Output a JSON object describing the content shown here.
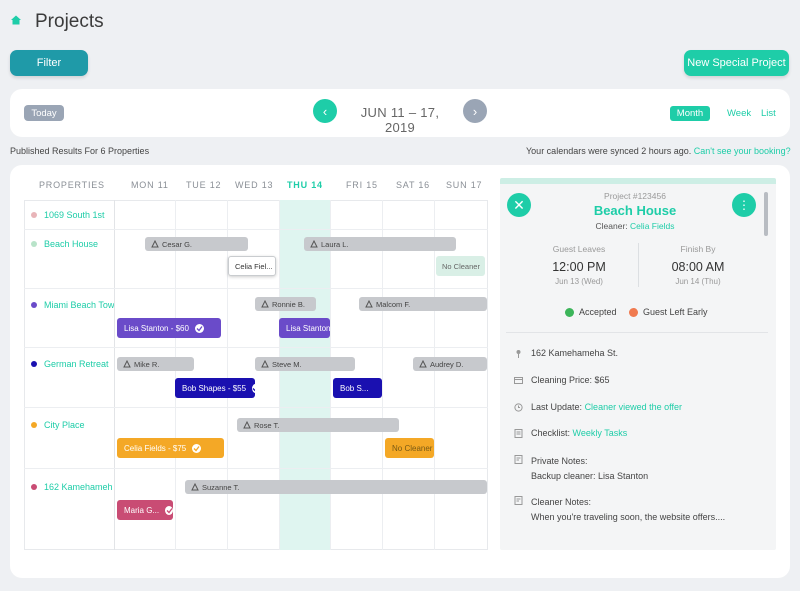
{
  "header": {
    "title": "Projects",
    "filter_label": "Filter",
    "new_project_label": "New Special Project"
  },
  "datebar": {
    "today": "Today",
    "range": "JUN 11 – 17, 2019",
    "views": {
      "month": "Month",
      "week": "Week",
      "list": "List"
    }
  },
  "status": {
    "published": "Published Results For 6 Properties",
    "synced": "Your calendars were synced 2 hours ago.",
    "synced_link": "Can't see your booking?"
  },
  "calendar": {
    "properties_header": "PROPERTIES",
    "days": [
      "MON 11",
      "TUE 12",
      "WED 13",
      "THU 14",
      "FRI 15",
      "SAT 16",
      "SUN 17"
    ],
    "properties": [
      {
        "name": "1069 South 1st",
        "color": "#e8b4b8"
      },
      {
        "name": "Beach House",
        "color": "#b8e3c9"
      },
      {
        "name": "Miami Beach Tow",
        "color": "#6a4bc9"
      },
      {
        "name": "German Retreat",
        "color": "#1a10b0"
      },
      {
        "name": "City Place",
        "color": "#f4a826"
      },
      {
        "name": "162 Kamehameh",
        "color": "#c94c74"
      }
    ],
    "events": {
      "cesar": "Cesar G.",
      "laura": "Laura L.",
      "celia_w": "Celia Fiel...",
      "no_cleaner_1": "No Cleaner",
      "ronnie": "Ronnie B.",
      "malcom": "Malcom F.",
      "lisa_60": "Lisa Stanton - $60",
      "lisa": "Lisa Stanton",
      "mike": "Mike R.",
      "steve": "Steve M.",
      "audrey": "Audrey D.",
      "bob_55": "Bob Shapes - $55",
      "bob_s": "Bob S...",
      "rose": "Rose T.",
      "celia_75": "Celia Fields - $75",
      "no_cleaner_2": "No Cleaner",
      "suzanne": "Suzanne T.",
      "maria": "Maria G..."
    }
  },
  "detail": {
    "project_number": "Project #123456",
    "project_name": "Beach House",
    "cleaner_label": "Cleaner:",
    "cleaner_name": "Celia Fields",
    "guest_leaves_label": "Guest Leaves",
    "guest_leaves_time": "12:00 PM",
    "guest_leaves_date": "Jun 13 (Wed)",
    "finish_by_label": "Finish By",
    "finish_by_time": "08:00 AM",
    "finish_by_date": "Jun 14 (Thu)",
    "accepted": "Accepted",
    "guest_left_early": "Guest Left Early",
    "address": "162 Kamehameha St.",
    "cleaning_price": "Cleaning Price: $65",
    "last_update_label": "Last Update:",
    "last_update_value": "Cleaner viewed the offer",
    "checklist_label": "Checklist:",
    "checklist_value": "Weekly Tasks",
    "private_notes_label": "Private Notes:",
    "private_notes_value": "Backup cleaner: Lisa Stanton",
    "cleaner_notes_label": "Cleaner Notes:",
    "cleaner_notes_value": "When you're traveling soon, the website offers...."
  },
  "colors": {
    "accent": "#1ecda8",
    "filter": "#1f9aa8",
    "gray_event": "#c7c9cd",
    "purple": "#6a4bc9",
    "blue": "#1a10b0",
    "orange": "#f4a826",
    "pink": "#c94c74"
  }
}
